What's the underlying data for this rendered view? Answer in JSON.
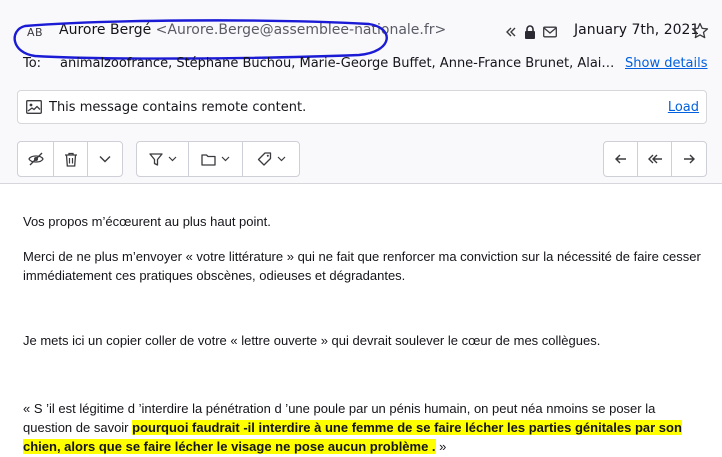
{
  "header": {
    "avatar_initials": "AB",
    "sender_name": "Aurore Bergé",
    "sender_email": "<Aurore.Berge@assemblee-nationale.fr>",
    "date": "January 7th, 2021",
    "icons": [
      "reply-all-icon",
      "lock-icon",
      "envelope-icon",
      "star-icon"
    ],
    "annotation_color": "#1b1bd6",
    "to_label": "To:",
    "to_list": "animalzoofrance, Stéphane Buchou, Marie-George Buffet, Anne-France Brunet, Alain Bruneel, Bruno Bilde",
    "show_details": "Show details"
  },
  "remote": {
    "message": "This message contains remote content.",
    "load": "Load"
  },
  "toolbar": {
    "icons": [
      "hide-icon",
      "trash-icon",
      "chevron-down-icon",
      "filter-icon",
      "folder-icon",
      "tag-icon",
      "reply-icon",
      "reply-all-icon",
      "forward-icon"
    ]
  },
  "body": {
    "p1": "Vos propos m’écœurent au plus haut point.",
    "p2": "Merci de ne plus m’envoyer « votre littérature » qui ne fait que renforcer ma conviction sur la nécessité de faire cesser immédiatement ces pratiques obscènes, odieuses et dégradantes.",
    "p3": "Je mets ici un copier coller de votre « lettre ouverte » qui devrait soulever le cœur de mes collègues.",
    "p4_before": "« S ’il est légitime d ’interdire la pénétration d ’une poule par un pénis humain, on peut néa nmoins se poser la question de savoir ",
    "p4_highlight": "pourquoi faudrait -il interdire à une femme de se faire lécher les parties génitales par son chien, alors que se faire lécher le visage ne pose aucun problème .",
    "p4_after": " »",
    "highlight_color": "#ffff00"
  }
}
